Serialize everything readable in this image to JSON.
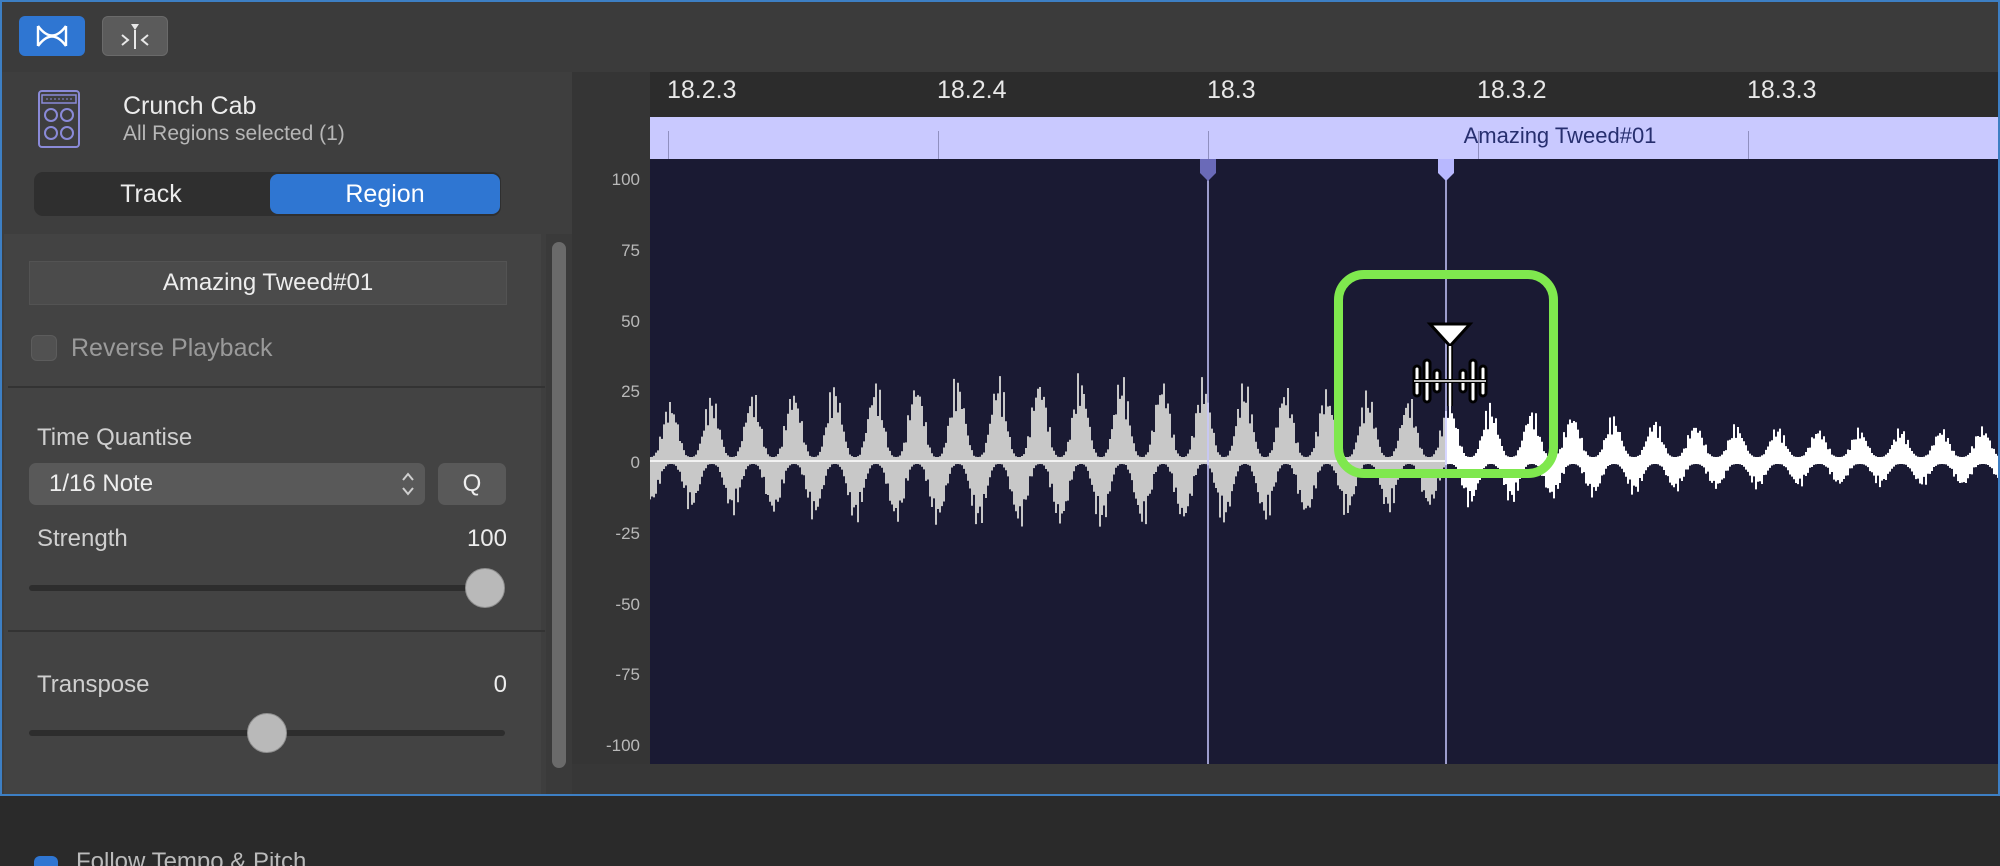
{
  "toolbar": {
    "buttons": [
      {
        "icon": "flex-time-icon",
        "active": true
      },
      {
        "icon": "pitch-marker-icon",
        "active": false
      }
    ]
  },
  "inspector": {
    "track_name": "Crunch Cab",
    "track_subtitle": "All Regions selected (1)",
    "icon": "amp-icon",
    "tabs": [
      {
        "label": "Track",
        "active": false
      },
      {
        "label": "Region",
        "active": true
      }
    ],
    "region_name": "Amazing Tweed#01",
    "reverse_playback": {
      "label": "Reverse Playback",
      "checked": false
    },
    "time_quantise": {
      "label": "Time Quantise",
      "value": "1/16 Note",
      "q_button": "Q"
    },
    "strength": {
      "label": "Strength",
      "value": "100",
      "level": 1.0
    },
    "transpose": {
      "label": "Transpose",
      "value": "0",
      "level": 0.5
    },
    "follow_tempo": {
      "label": "Follow Tempo & Pitch",
      "checked": true
    }
  },
  "editor": {
    "ruler_labels": [
      "18.2.3",
      "18.2.4",
      "18.3",
      "18.3.2",
      "18.3.3"
    ],
    "region_title": "Amazing Tweed#01",
    "y_ticks": [
      "100",
      "75",
      "50",
      "25",
      "0",
      "-25",
      "-50",
      "-75",
      "-100"
    ],
    "cursor_icon": "flex-marker-cursor-icon",
    "colors": {
      "waveform_before": "#c8c8c8",
      "waveform_after": "#ffffff",
      "canvas_bg": "#1a1a33",
      "region_bar": "#c9c9ff",
      "highlight": "#7fe84e",
      "accent": "#2f76d2"
    }
  }
}
